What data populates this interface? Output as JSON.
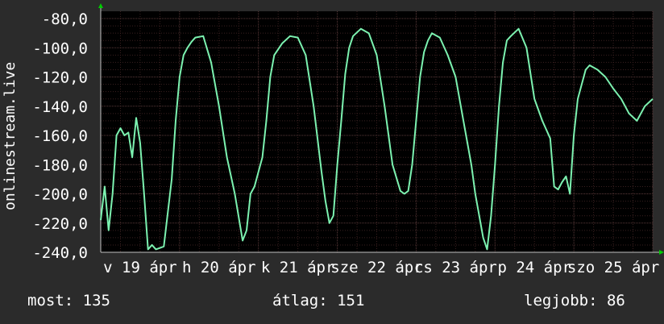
{
  "chart_data": {
    "type": "line",
    "ylabel": "onlinestream.live",
    "ylim": [
      -240,
      -75
    ],
    "yticks": [
      "-80,0",
      "-100,0",
      "-120,0",
      "-140,0",
      "-160,0",
      "-180,0",
      "-200,0",
      "-220,0",
      "-240,0"
    ],
    "ytick_values": [
      -80,
      -100,
      -120,
      -140,
      -160,
      -180,
      -200,
      -220,
      -240
    ],
    "xticks": [
      "v 19 ápr",
      "h 20 ápr",
      "k 21 ápr",
      "sze 22 ápr",
      "cs 23 ápr",
      "p 24 ápr",
      "szo 25 ápr"
    ],
    "xlim": [
      0,
      7
    ],
    "grid": true,
    "colors": {
      "background": "#000000",
      "line": "#7cf2b0",
      "grid": "#5a3a3a",
      "axis": "#c0c0c0",
      "arrow": "#00cc00"
    },
    "series": [
      {
        "x": [
          0.0,
          0.05,
          0.1,
          0.15,
          0.2,
          0.25,
          0.3,
          0.35,
          0.4,
          0.45,
          0.5,
          0.55,
          0.6,
          0.65,
          0.7,
          0.8,
          0.9,
          0.95,
          1.0,
          1.05,
          1.1,
          1.15,
          1.2,
          1.3,
          1.4,
          1.5,
          1.6,
          1.7,
          1.8,
          1.85,
          1.9,
          1.95,
          2.0,
          2.05,
          2.1,
          2.15,
          2.2,
          2.3,
          2.4,
          2.5,
          2.6,
          2.7,
          2.8,
          2.85,
          2.9,
          2.95,
          3.0,
          3.05,
          3.1,
          3.15,
          3.2,
          3.3,
          3.4,
          3.5,
          3.6,
          3.7,
          3.8,
          3.85,
          3.9,
          3.95,
          4.0,
          4.05,
          4.1,
          4.15,
          4.2,
          4.3,
          4.4,
          4.5,
          4.6,
          4.7,
          4.75,
          4.8,
          4.85,
          4.9,
          4.95,
          5.0,
          5.05,
          5.1,
          5.15,
          5.2,
          5.3,
          5.4,
          5.5,
          5.6,
          5.7,
          5.75,
          5.8,
          5.85,
          5.9,
          5.95,
          6.0,
          6.05,
          6.1,
          6.15,
          6.2,
          6.3,
          6.4,
          6.5,
          6.6,
          6.7,
          6.8,
          6.9,
          7.0
        ],
        "values": [
          -218,
          -195,
          -225,
          -200,
          -160,
          -155,
          -160,
          -158,
          -175,
          -148,
          -165,
          -200,
          -238,
          -235,
          -238,
          -236,
          -190,
          -150,
          -120,
          -105,
          -100,
          -96,
          -93,
          -92,
          -110,
          -140,
          -175,
          -200,
          -232,
          -225,
          -200,
          -195,
          -185,
          -175,
          -150,
          -120,
          -105,
          -97,
          -92,
          -93,
          -105,
          -140,
          -185,
          -205,
          -220,
          -215,
          -180,
          -150,
          -118,
          -100,
          -92,
          -87,
          -90,
          -105,
          -140,
          -180,
          -198,
          -200,
          -198,
          -180,
          -150,
          -120,
          -103,
          -95,
          -90,
          -93,
          -105,
          -120,
          -150,
          -180,
          -200,
          -215,
          -230,
          -238,
          -215,
          -180,
          -140,
          -110,
          -95,
          -92,
          -87,
          -100,
          -135,
          -150,
          -162,
          -195,
          -197,
          -192,
          -188,
          -200,
          -160,
          -135,
          -125,
          -115,
          -112,
          -115,
          -120,
          -128,
          -135,
          -145,
          -150,
          -140,
          -135
        ]
      }
    ]
  },
  "footer": {
    "now": "most: 135",
    "avg": "átlag: 151",
    "best": "legjobb: 86"
  }
}
